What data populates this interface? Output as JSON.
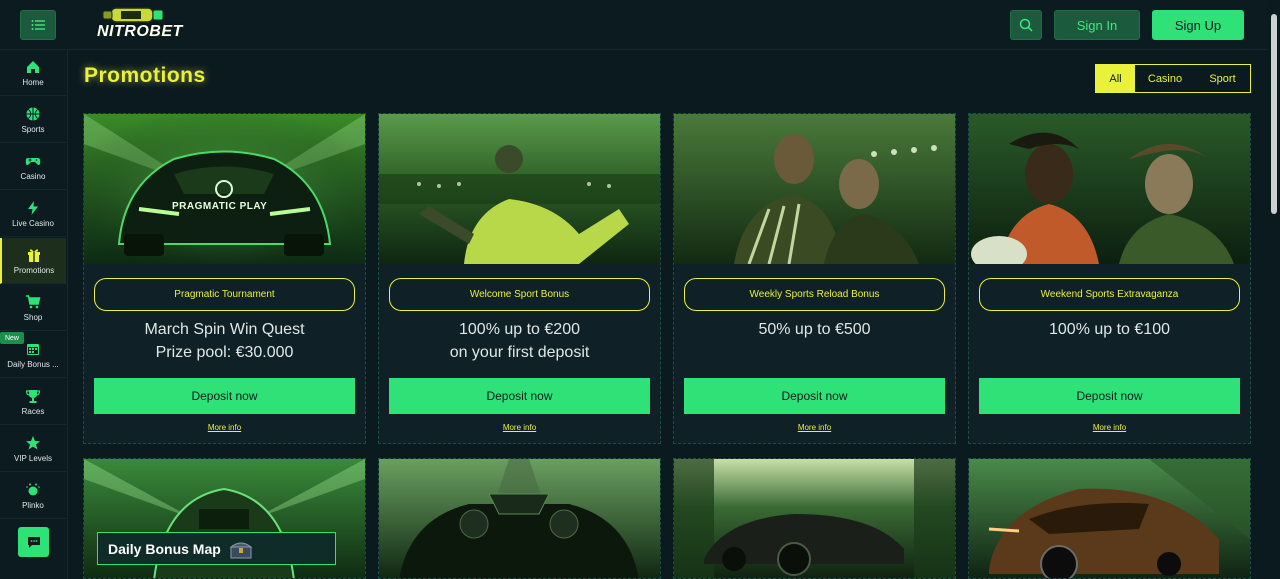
{
  "header": {
    "logo_text": "NITROBET",
    "signin": "Sign In",
    "signup": "Sign Up"
  },
  "sidebar": {
    "items": [
      {
        "label": "Home"
      },
      {
        "label": "Sports"
      },
      {
        "label": "Casino"
      },
      {
        "label": "Live Casino"
      },
      {
        "label": "Promotions"
      },
      {
        "label": "Shop"
      },
      {
        "label": "Daily Bonus ..."
      },
      {
        "label": "Races"
      },
      {
        "label": "VIP Levels"
      },
      {
        "label": "Plinko"
      }
    ],
    "new_badge": "New"
  },
  "page": {
    "title": "Promotions",
    "filters": [
      "All",
      "Casino",
      "Sport"
    ]
  },
  "cards": [
    {
      "tag": "Pragmatic Tournament",
      "line1": "March Spin Win Quest",
      "line2": "Prize pool: €30.000",
      "cta": "Deposit now",
      "more": "More info",
      "img_text": "PRAGMATIC PLAY"
    },
    {
      "tag": "Welcome Sport Bonus",
      "line1": "100% up to €200",
      "line2": "on your first deposit",
      "cta": "Deposit now",
      "more": "More info"
    },
    {
      "tag": "Weekly Sports Reload Bonus",
      "line1": "50% up to €500",
      "line2": "",
      "cta": "Deposit now",
      "more": "More info"
    },
    {
      "tag": "Weekend Sports Extravaganza",
      "line1": "100% up to €100",
      "line2": "",
      "cta": "Deposit now",
      "more": "More info"
    }
  ],
  "row2": {
    "daily_bonus_map": "Daily Bonus Map"
  },
  "colors": {
    "accent": "#e9f13a",
    "primary": "#2fe278",
    "background": "#0b1a1f"
  }
}
